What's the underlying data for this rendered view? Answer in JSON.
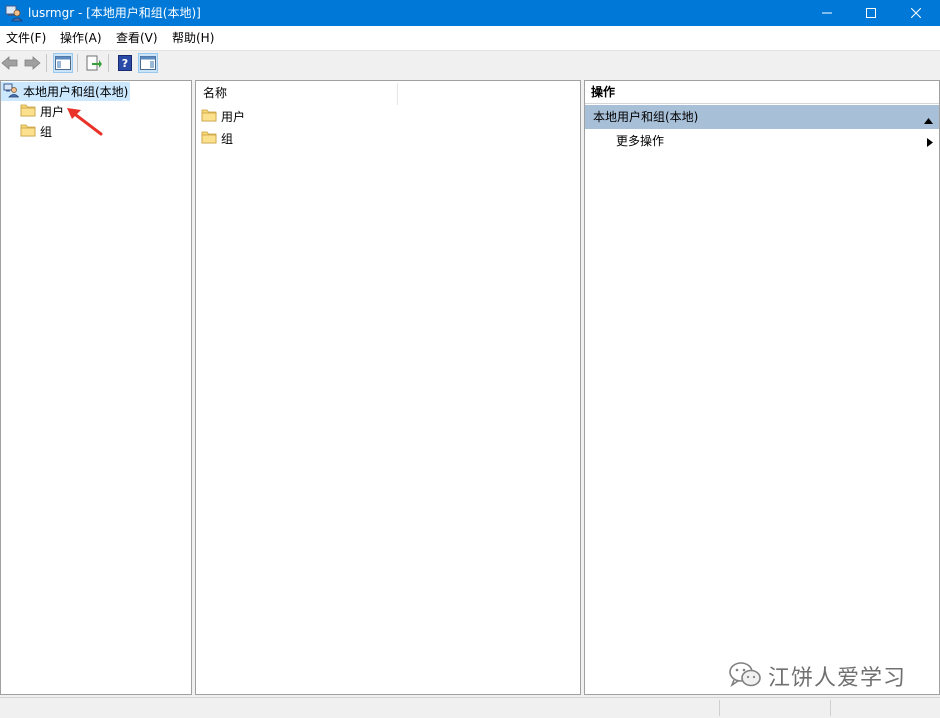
{
  "window": {
    "title": "lusrmgr - [本地用户和组(本地)]"
  },
  "menu": [
    "文件(F)",
    "操作(A)",
    "查看(V)",
    "帮助(H)"
  ],
  "toolbar": {
    "icons": [
      "back-arrow-icon",
      "forward-arrow-icon",
      "show-hide-tree-icon",
      "export-list-icon",
      "help-icon",
      "show-hide-action-pane-icon"
    ]
  },
  "tree": {
    "root": "本地用户和组(本地)",
    "items": [
      "用户",
      "组"
    ]
  },
  "list": {
    "column_header": "名称",
    "rows": [
      "用户",
      "组"
    ]
  },
  "actions": {
    "header": "操作",
    "section": "本地用户和组(本地)",
    "items": [
      "更多操作"
    ]
  },
  "watermark": "江饼人爱学习",
  "colors": {
    "titlebar": "#0078d7",
    "selection": "#cce8ff",
    "action_section": "#a8bfd8",
    "annotation_arrow": "#e8322a"
  }
}
